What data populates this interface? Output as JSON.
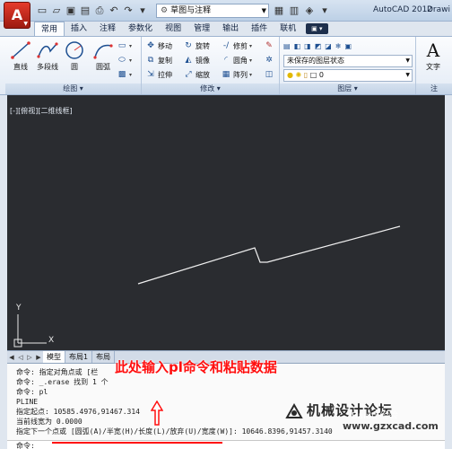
{
  "titlebar": {
    "app_button_letter": "A",
    "workspace": "草图与注释",
    "app_title": "AutoCAD 2012",
    "title_right": "Drawi"
  },
  "ribbon_tabs": [
    "常用",
    "插入",
    "注释",
    "参数化",
    "视图",
    "管理",
    "输出",
    "插件",
    "联机"
  ],
  "ribbon": {
    "draw": {
      "title": "绘图",
      "tools": [
        "直线",
        "多段线",
        "圆",
        "圆弧"
      ]
    },
    "modify": {
      "title": "修改",
      "col1": [
        "移动",
        "复制",
        "拉伸"
      ],
      "col2": [
        "旋转",
        "镜像",
        "缩放"
      ],
      "col3": [
        "修剪",
        "圆角",
        "阵列"
      ]
    },
    "layers": {
      "title": "图层",
      "state": "未保存的图层状态",
      "current": "0"
    },
    "annotation": {
      "title": "注",
      "tool": "文字"
    }
  },
  "viewport": {
    "label_prefix": "[-]",
    "label_view": "[俯视]",
    "label_style": "[二维线框]"
  },
  "ucs": {
    "x": "X",
    "y": "Y"
  },
  "layout_tabs": [
    "模型",
    "布局1",
    "布局"
  ],
  "command_lines": [
    "命令: 指定对角点或 [栏",
    "命令: _.erase 找到 1 个",
    "命令: pl",
    "PLINE",
    "指定起点: 10585.4976,91467.314",
    "当前线宽为 0.0000",
    "指定下一个点或 [圆弧(A)/半宽(H)/长度(L)/放弃(U)/宽度(W)]: 10646.8396,91457.3140"
  ],
  "command_prompt": "命令:",
  "annotations": {
    "callout": "此处输入pl命令和粘贴数据",
    "watermark_site": "机械设计论坛",
    "watermark_url": "www.gzxcad.com",
    "watermark_overlay": "Baidu 经验"
  }
}
